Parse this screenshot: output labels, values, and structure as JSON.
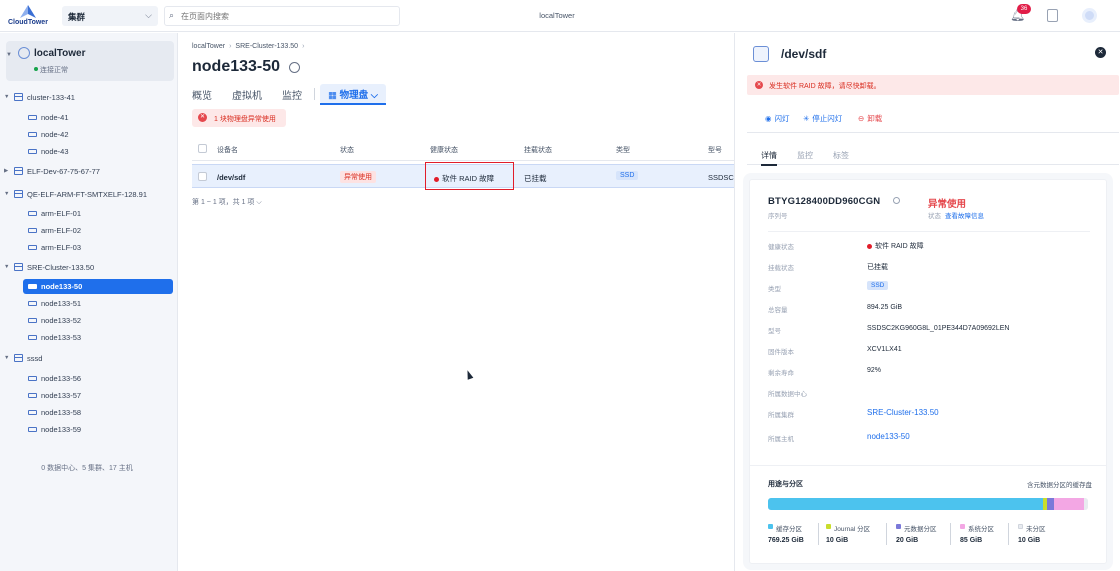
{
  "topbar": {
    "logo_text": "CloudTower",
    "scope_select": "集群",
    "search_placeholder": "在页面内搜索",
    "app_title": "localTower",
    "notification_count": "36"
  },
  "sidebar": {
    "datacenter": {
      "name": "localTower",
      "status": "连接正常"
    },
    "clusters": [
      {
        "name": "cluster-133-41",
        "hosts": [
          "node-41",
          "node-42",
          "node-43"
        ]
      },
      {
        "name": "ELF-Dev-67-75-67-77",
        "hosts": []
      },
      {
        "name": "QE-ELF-ARM-FT-SMTXELF-128.91",
        "hosts": [
          "arm-ELF-01",
          "arm-ELF-02",
          "arm-ELF-03"
        ]
      },
      {
        "name": "SRE-Cluster-133.50",
        "hosts": [
          "node133-50",
          "node133-51",
          "node133-52",
          "node133-53"
        ]
      },
      {
        "name": "sssd",
        "hosts": [
          "node133-56",
          "node133-57",
          "node133-58",
          "node133-59"
        ]
      }
    ],
    "selected_host": "node133-50",
    "footer": "0 数据中心、5 集群、17 主机"
  },
  "main": {
    "breadcrumb": [
      "localTower",
      "SRE-Cluster-133.50"
    ],
    "title": "node133-50",
    "tabs": [
      "概览",
      "虚拟机",
      "监控"
    ],
    "active_tab": "物理盘",
    "alert": "1 块物理盘异常使用",
    "table": {
      "headers": [
        "设备名",
        "状态",
        "健康状态",
        "挂载状态",
        "类型",
        "型号"
      ],
      "rows": [
        {
          "device": "/dev/sdf",
          "status": "异常使用",
          "health": "软件 RAID 故障",
          "mount": "已挂载",
          "type": "SSD",
          "model": "SSDSC"
        }
      ]
    },
    "pager": "第 1 ~ 1 项，共 1 项"
  },
  "panel": {
    "title": "/dev/sdf",
    "alert": "发生软件 RAID 故障，请尽快卸载。",
    "actions": [
      "闪灯",
      "停止闪灯",
      "卸载"
    ],
    "tabs": [
      "详情",
      "监控",
      "标签"
    ],
    "serial": "BTYG128400DD960CGN",
    "serial_label": "序列号",
    "state_value": "异常使用",
    "state_label": "状态",
    "state_link": "查看故障信息",
    "fields": [
      {
        "key": "健康状态",
        "value": "软件 RAID 故障",
        "kind": "dot"
      },
      {
        "key": "挂载状态",
        "value": "已挂载",
        "kind": "text"
      },
      {
        "key": "类型",
        "value": "SSD",
        "kind": "tag"
      },
      {
        "key": "总容量",
        "value": "894.25 GiB",
        "kind": "text"
      },
      {
        "key": "型号",
        "value": "SSDSC2KG960G8L_01PE344D7A09692LEN",
        "kind": "text"
      },
      {
        "key": "固件版本",
        "value": "XCV1LX41",
        "kind": "text"
      },
      {
        "key": "剩余寿命",
        "value": "92%",
        "kind": "text"
      },
      {
        "key": "所属数据中心",
        "value": "",
        "kind": "text"
      },
      {
        "key": "所属集群",
        "value": "SRE-Cluster-133.50",
        "kind": "link"
      },
      {
        "key": "所属主机",
        "value": "node133-50",
        "kind": "link"
      }
    ],
    "usage": {
      "title": "用途与分区",
      "right_label": "含元数据分区的缓存盘",
      "partitions": [
        {
          "name": "缓存分区",
          "value": "769.25 GiB",
          "gib": 769.25,
          "color": "#4cc3ee"
        },
        {
          "name": "Journal 分区",
          "value": "10 GiB",
          "gib": 10,
          "color": "#c9dd2c"
        },
        {
          "name": "元数据分区",
          "value": "20 GiB",
          "gib": 20,
          "color": "#7b79d9"
        },
        {
          "name": "系统分区",
          "value": "85 GiB",
          "gib": 85,
          "color": "#f3a7e4"
        },
        {
          "name": "未分区",
          "value": "10 GiB",
          "gib": 10,
          "color": "#e8ebf0"
        }
      ]
    }
  }
}
